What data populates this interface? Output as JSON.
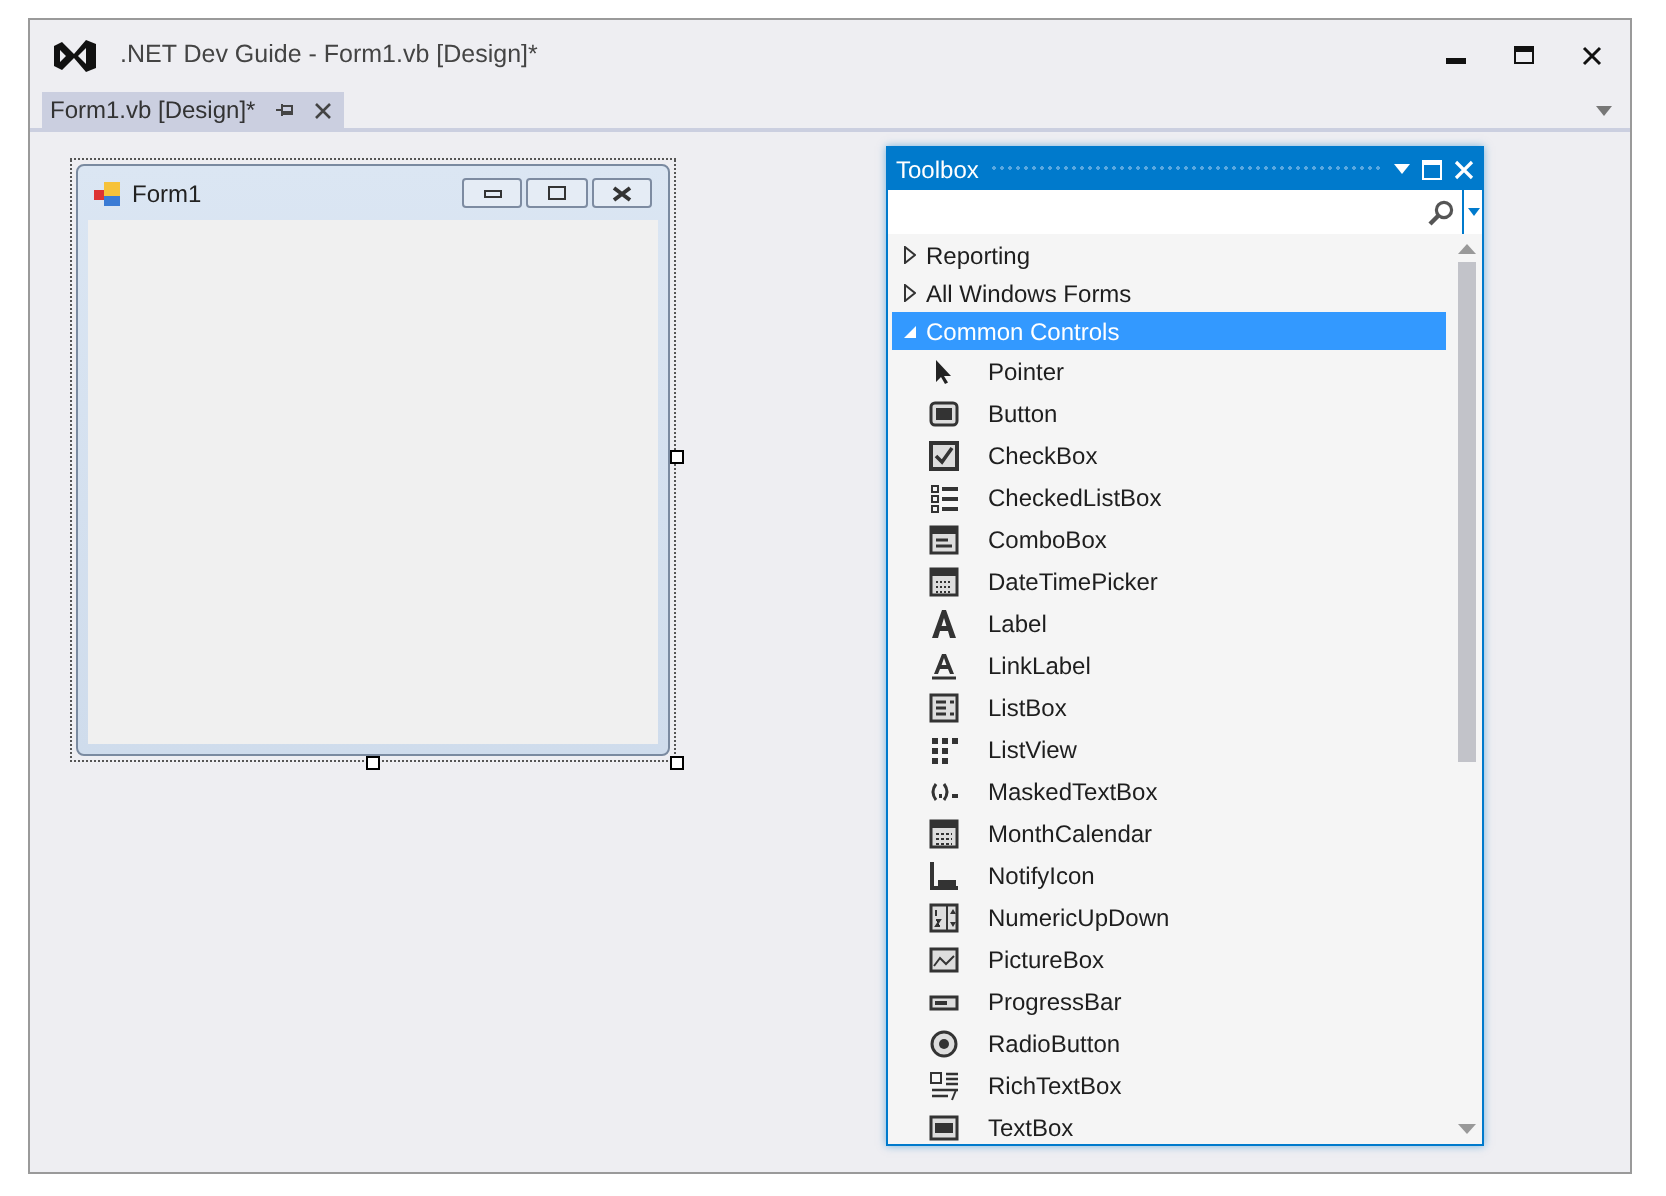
{
  "window": {
    "title": ".NET Dev Guide - Form1.vb [Design]*"
  },
  "tabs": [
    {
      "label": "Form1.vb [Design]*",
      "selected": true
    }
  ],
  "form": {
    "title": "Form1",
    "selected": true
  },
  "toolbox": {
    "title": "Toolbox",
    "groups": [
      {
        "label": "Reporting",
        "expanded": false,
        "selected": false
      },
      {
        "label": "All Windows Forms",
        "expanded": false,
        "selected": false
      },
      {
        "label": "Common Controls",
        "expanded": true,
        "selected": true,
        "children": [
          {
            "label": "Pointer"
          },
          {
            "label": "Button"
          },
          {
            "label": "CheckBox"
          },
          {
            "label": "CheckedListBox"
          },
          {
            "label": "ComboBox"
          },
          {
            "label": "DateTimePicker"
          },
          {
            "label": "Label"
          },
          {
            "label": "LinkLabel"
          },
          {
            "label": "ListBox"
          },
          {
            "label": "ListView"
          },
          {
            "label": "MaskedTextBox"
          },
          {
            "label": "MonthCalendar"
          },
          {
            "label": "NotifyIcon"
          },
          {
            "label": "NumericUpDown"
          },
          {
            "label": "PictureBox"
          },
          {
            "label": "ProgressBar"
          },
          {
            "label": "RadioButton"
          },
          {
            "label": "RichTextBox"
          },
          {
            "label": "TextBox"
          }
        ]
      }
    ]
  }
}
